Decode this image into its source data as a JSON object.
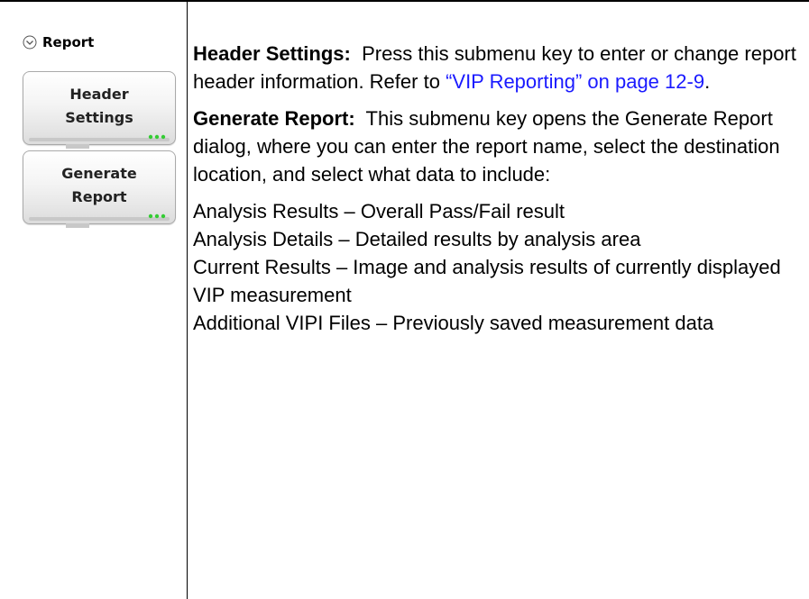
{
  "submenu": {
    "icon": "chevron-down-circle-icon",
    "title": "Report",
    "keys": [
      {
        "label": "Header\nSettings",
        "icon": "more-options-icon"
      },
      {
        "label": "Generate\nReport",
        "icon": "more-options-icon"
      }
    ],
    "more_options_color": "#33cc33"
  },
  "descriptions": {
    "header_settings": {
      "term": "Header Settings:",
      "text": "Press this submenu key to enter or change report header information. Refer to",
      "link_text": "“VIP Reporting” on page 12-9",
      "after_link": "."
    },
    "generate_report": {
      "term": "Generate Report:",
      "text": "This submenu key opens the Generate Report dialog, where you can enter the report name, select the destination location, and select what data to include:"
    },
    "include_items": [
      "Analysis Results – Overall Pass/Fail result",
      "Analysis Details – Detailed results by analysis area",
      "Current Results – Image and analysis results of currently displayed VIP measurement",
      "Additional VIPI Files – Previously saved measurement data"
    ]
  },
  "colors": {
    "link": "#1a1aff",
    "indicator_green": "#33cc33"
  }
}
